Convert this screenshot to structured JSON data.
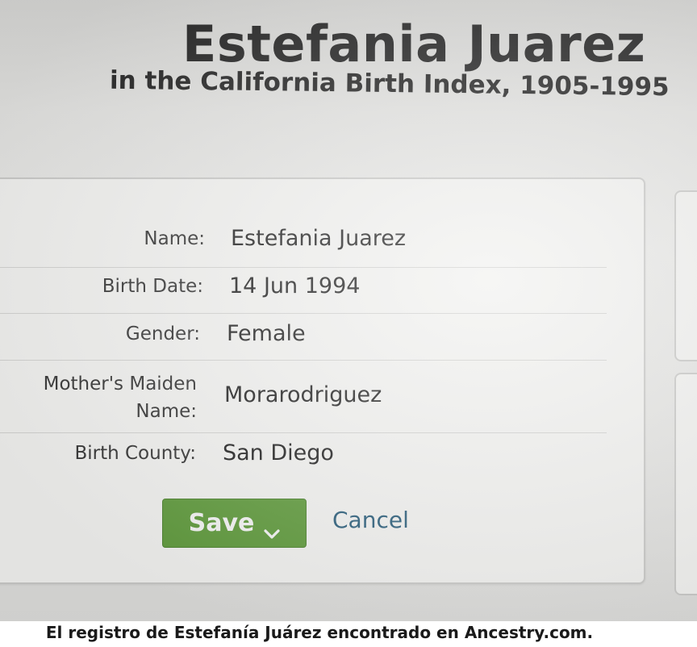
{
  "header": {
    "title": "Estefania Juarez",
    "subtitle": "in the California Birth Index, 1905-1995"
  },
  "record": {
    "fields": [
      {
        "label": "Name:",
        "value": "Estefania Juarez"
      },
      {
        "label": "Birth Date:",
        "value": "14 Jun 1994"
      },
      {
        "label": "Gender:",
        "value": "Female"
      },
      {
        "label": "Mother's Maiden Name:",
        "value": "Morarodriguez"
      },
      {
        "label": "Birth County:",
        "value": "San Diego"
      }
    ]
  },
  "actions": {
    "save_label": "Save",
    "save_icon": "chevron-down-icon",
    "cancel_label": "Cancel"
  },
  "colors": {
    "save_button": "#5f9a3c",
    "cancel_link": "#2a5d7a"
  },
  "caption": "El registro de Estefanía Juárez encontrado en Ancestry.com."
}
